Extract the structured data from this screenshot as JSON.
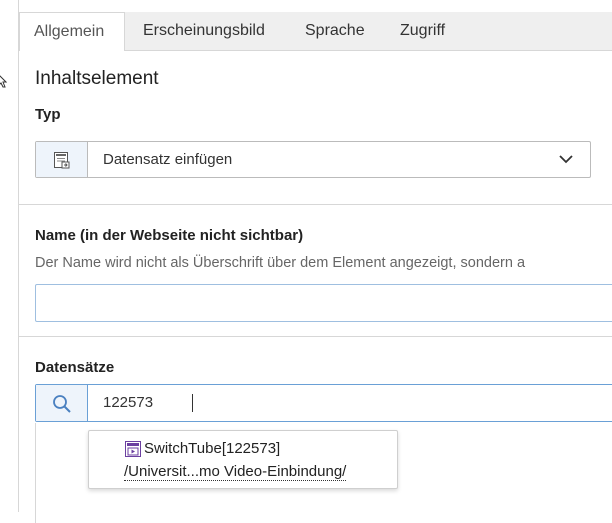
{
  "tabs": [
    {
      "label": "Allgemein",
      "active": true
    },
    {
      "label": "Erscheinungsbild",
      "active": false
    },
    {
      "label": "Sprache",
      "active": false
    },
    {
      "label": "Zugriff",
      "active": false
    }
  ],
  "section_title": "Inhaltselement",
  "type_field": {
    "label": "Typ",
    "value": "Datensatz einfügen",
    "icon": "record-insert-icon"
  },
  "name_field": {
    "label": "Name (in der Webseite nicht sichtbar)",
    "help": "Der Name wird nicht als Überschrift über dem Element angezeigt, sondern a",
    "value": ""
  },
  "records_field": {
    "label": "Datensätze",
    "search_value": "122573",
    "results": [
      {
        "title": "SwitchTube[122573]",
        "path": "/Universit...mo Video-Einbindung/",
        "icon": "switchtube-record-icon"
      }
    ]
  },
  "colors": {
    "tab_bar": "#efefef",
    "addon_bg": "#eef4fb",
    "focus_border": "#6aa0d6",
    "record_icon": "#6b3fa0"
  }
}
